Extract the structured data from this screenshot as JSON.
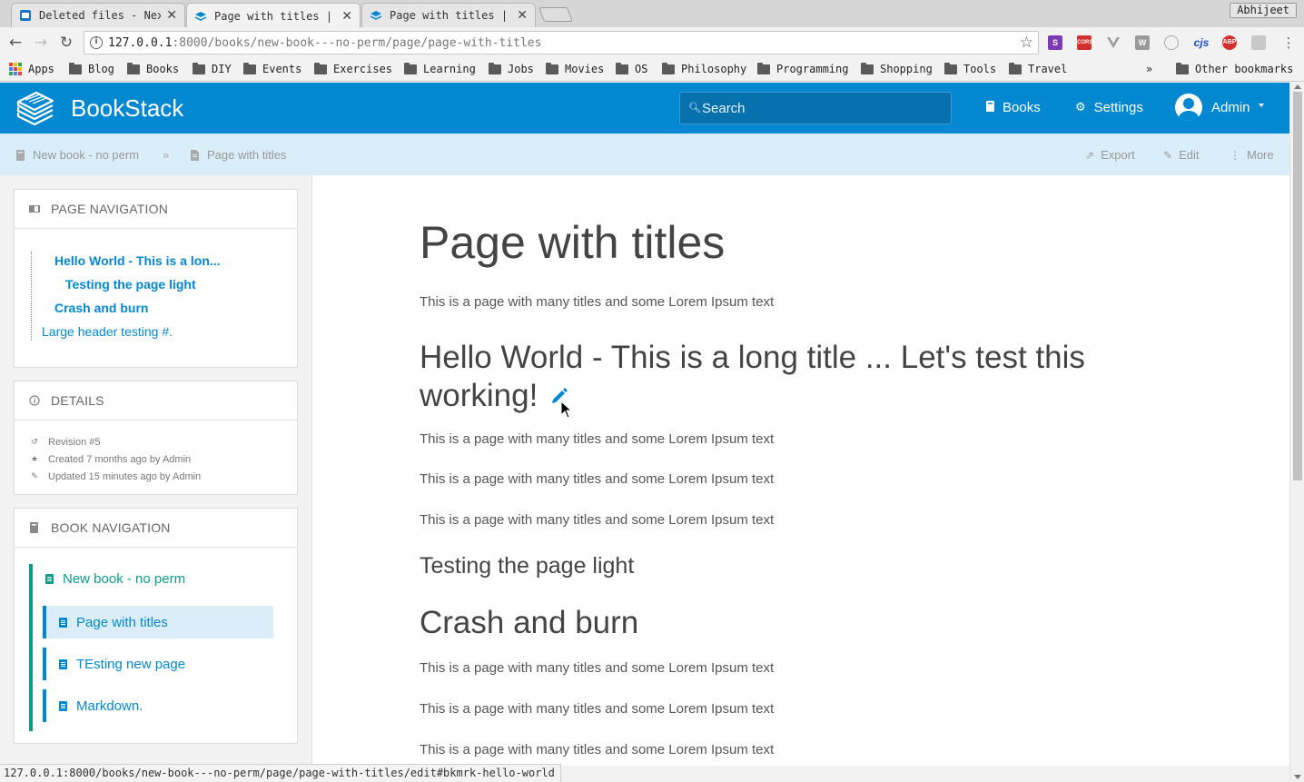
{
  "browser": {
    "tabs": [
      {
        "title": "Deleted files - Nex",
        "active": false
      },
      {
        "title": "Page with titles |",
        "active": true
      },
      {
        "title": "Page with titles |",
        "active": false
      }
    ],
    "profile_name": "Abhijeet",
    "url_host": "127.0.0.1",
    "url_rest": ":8000/books/new-book---no-perm/page/page-with-titles",
    "extensions": [
      "S",
      "CORS",
      "",
      "W",
      "",
      "cjs",
      "ABP",
      ""
    ],
    "bookmarks": [
      "Apps",
      "Blog",
      "Books",
      "DIY",
      "Events",
      "Exercises",
      "Learning",
      "Jobs",
      "Movies",
      "OS",
      "Philosophy",
      "Programming",
      "Shopping",
      "Tools",
      "Travel"
    ],
    "bookmarks_overflow": "»",
    "other_bookmarks": "Other bookmarks",
    "status_url": "127.0.0.1:8000/books/new-book---no-perm/page/page-with-titles/edit#bkmrk-hello-world"
  },
  "header": {
    "app_name": "BookStack",
    "search_placeholder": "Search",
    "books_label": "Books",
    "settings_label": "Settings",
    "user_name": "Admin"
  },
  "breadcrumb": {
    "book": "New book - no perm",
    "separator": "»",
    "page": "Page with titles"
  },
  "actions": {
    "export": "Export",
    "edit": "Edit",
    "more": "More"
  },
  "page_navigation": {
    "title": "PAGE NAVIGATION",
    "items": [
      {
        "label": "Hello World - This is a lon...",
        "level": 2
      },
      {
        "label": "Testing the page light",
        "level": 3
      },
      {
        "label": "Crash and burn",
        "level": 2
      },
      {
        "label": "Large header testing #.",
        "level": 1
      }
    ]
  },
  "details": {
    "title": "DETAILS",
    "revision": "Revision #5",
    "created": "Created 7 months ago by Admin",
    "updated": "Updated 15 minutes ago by Admin"
  },
  "book_navigation": {
    "title": "BOOK NAVIGATION",
    "book": "New book - no perm",
    "pages": [
      {
        "label": "Page with titles",
        "selected": true
      },
      {
        "label": "TEsting new page",
        "selected": false
      },
      {
        "label": "Markdown.",
        "selected": false
      }
    ]
  },
  "content": {
    "title": "Page with titles",
    "intro": "This is a page with many titles and some Lorem Ipsum text",
    "h2_line1": "Hello World - This is a long title ... Let's test this",
    "h2_line2": "working!",
    "para1": "This is a page with many titles and some Lorem Ipsum text",
    "para2": "This is a page with many titles and some Lorem Ipsum text",
    "para3": "This is a page with many titles and some Lorem Ipsum text",
    "h3": "Testing the page light",
    "h2b": "Crash and burn",
    "para4": "This is a page with many titles and some Lorem Ipsum text",
    "para5": "This is a page with many titles and some Lorem Ipsum text",
    "para6": "This is a page with many titles and some Lorem Ipsum text"
  },
  "colors": {
    "brand": "#0288d1",
    "book_green": "#099e8a",
    "crumb_bg": "#d9eef9"
  }
}
